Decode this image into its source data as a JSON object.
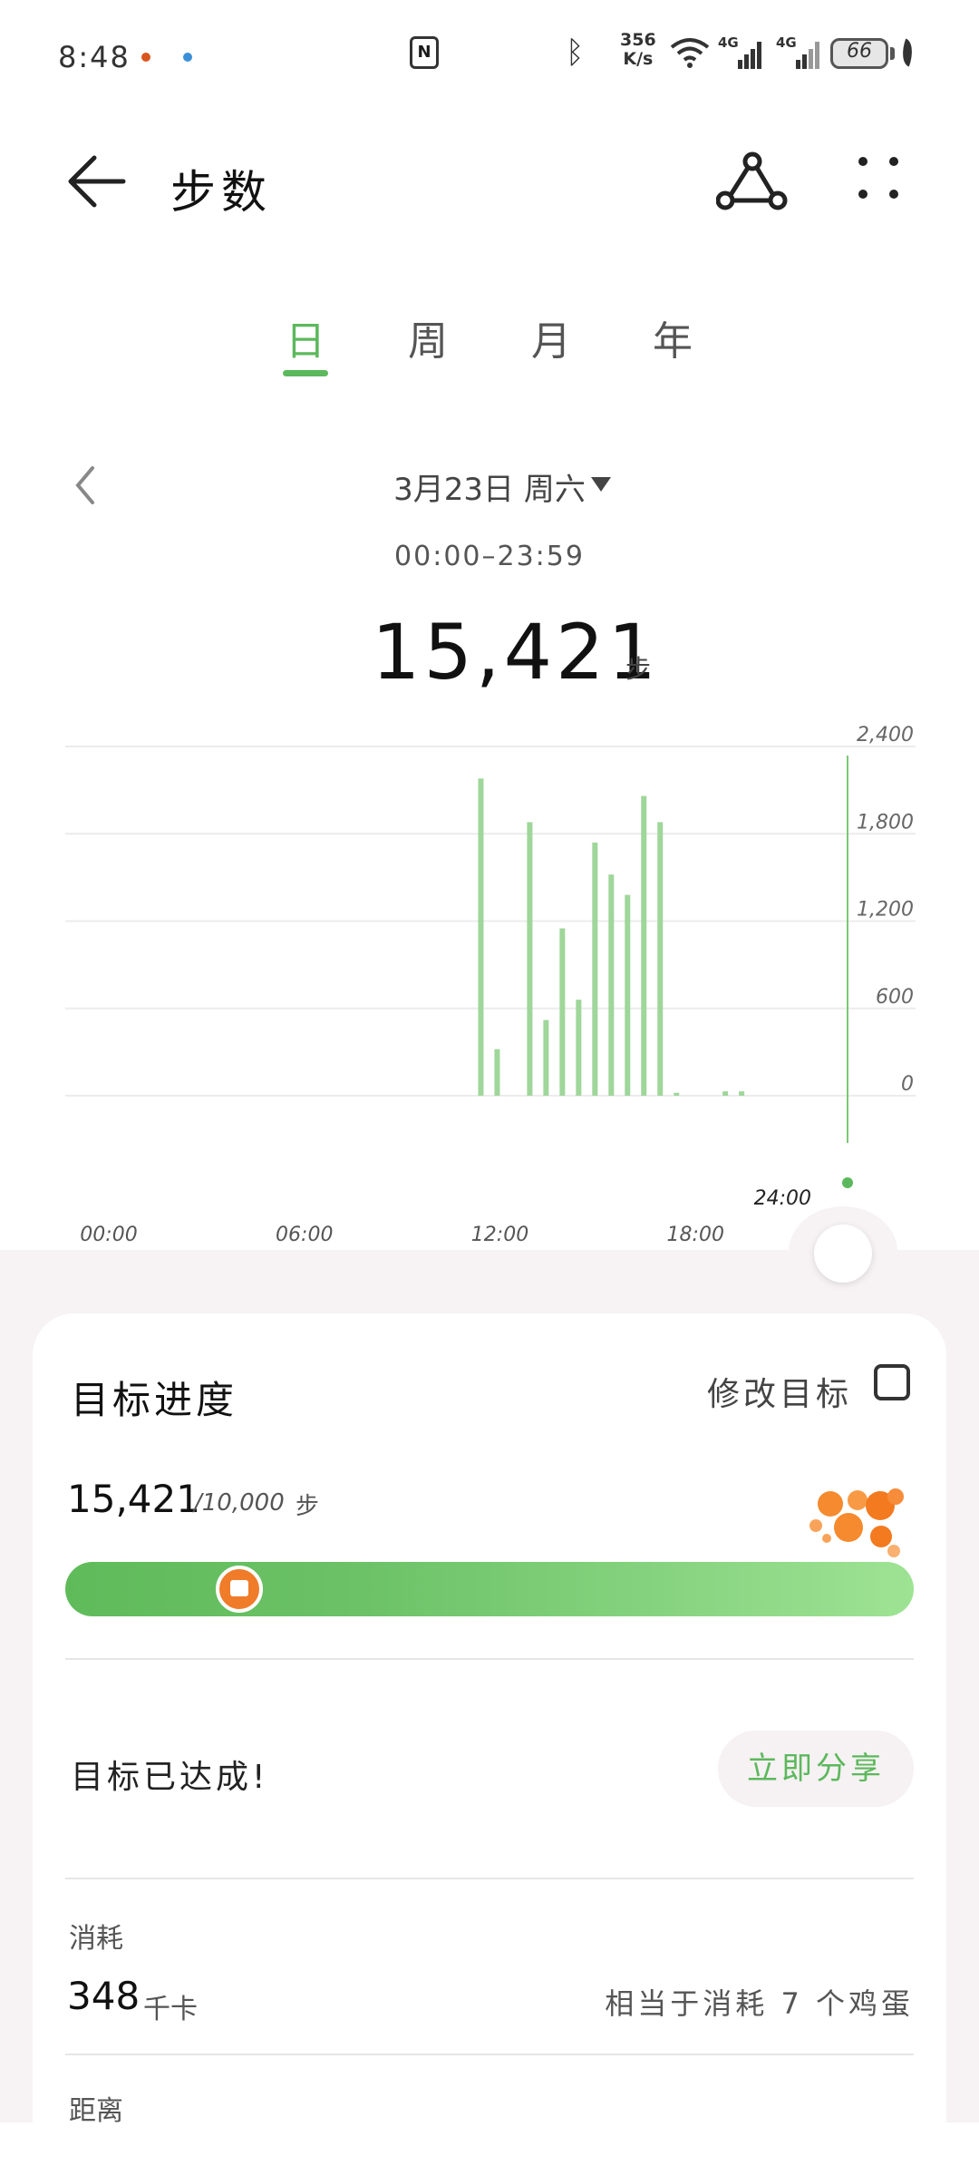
{
  "status_bar": {
    "time": "8:48",
    "network_speed_value": "356",
    "network_speed_unit": "K/s",
    "signal1": "4G",
    "signal2": "4G",
    "battery": "66"
  },
  "header": {
    "title": "步数"
  },
  "tabs": [
    {
      "label": "日",
      "active": true
    },
    {
      "label": "周",
      "active": false
    },
    {
      "label": "月",
      "active": false
    },
    {
      "label": "年",
      "active": false
    }
  ],
  "date": {
    "label": "3月23日 周六",
    "time_range": "00:00–23:59"
  },
  "summary": {
    "total_steps": "15,421",
    "unit": "步"
  },
  "chart_data": {
    "type": "bar",
    "x_tick_labels": [
      "00:00",
      "06:00",
      "12:00",
      "18:00"
    ],
    "end_label": "24:00",
    "y_tick_labels": [
      "2,400",
      "1,800",
      "1,200",
      "600",
      "0"
    ],
    "ylim": [
      0,
      2400
    ],
    "xlim_hours": [
      0,
      24
    ],
    "grid": true,
    "bars": [
      {
        "hour": 12.75,
        "value": 2180
      },
      {
        "hour": 13.25,
        "value": 320
      },
      {
        "hour": 14.25,
        "value": 1880
      },
      {
        "hour": 14.75,
        "value": 520
      },
      {
        "hour": 15.25,
        "value": 1150
      },
      {
        "hour": 15.75,
        "value": 660
      },
      {
        "hour": 16.25,
        "value": 1740
      },
      {
        "hour": 16.75,
        "value": 1520
      },
      {
        "hour": 17.25,
        "value": 1380
      },
      {
        "hour": 17.75,
        "value": 2060
      },
      {
        "hour": 18.25,
        "value": 1880
      },
      {
        "hour": 18.75,
        "value": 20
      },
      {
        "hour": 20.25,
        "value": 30
      },
      {
        "hour": 20.75,
        "value": 30
      }
    ],
    "bar_color": "#9fd69a"
  },
  "goal": {
    "title": "目标进度",
    "edit_label": "修改目标",
    "current": "15,421",
    "target": "/10,000",
    "target_unit": "步",
    "progress_fraction": 1.0,
    "achieved_text": "目标已达成!",
    "share_button": "立即分享"
  },
  "calories": {
    "label": "消耗",
    "value": "348",
    "unit": "千卡",
    "equivalent": "相当于消耗 7 个鸡蛋"
  },
  "distance": {
    "label": "距离"
  },
  "colors": {
    "accent": "#5cb85c",
    "bar": "#9fd69a"
  }
}
